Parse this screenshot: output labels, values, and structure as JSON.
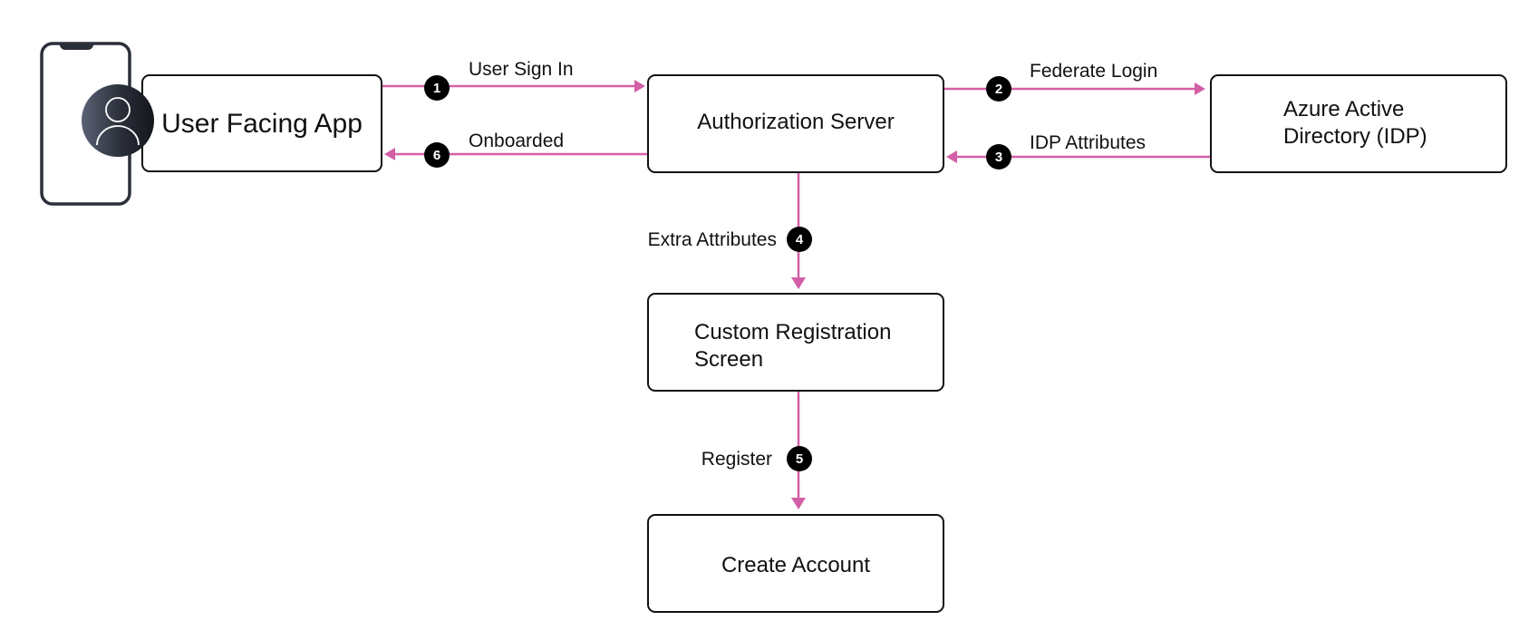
{
  "diagram": {
    "colors": {
      "edge": "#D35FA6",
      "node_border": "#111111",
      "badge_fill": "#000000",
      "badge_text": "#ffffff",
      "phone_frame": "#2b2f3a",
      "avatar_dark": "#1c1f27",
      "avatar_light": "#5a6275"
    },
    "nodes": {
      "user_app": {
        "label": "User Facing App",
        "icon": "user-avatar-icon",
        "device_icon": "smartphone-icon"
      },
      "auth_server": {
        "label": "Authorization Server"
      },
      "azure_ad": {
        "line1": "Azure Active",
        "line2": "Directory (IDP)"
      },
      "custom_reg": {
        "line1": "Custom Registration",
        "line2": "Screen"
      },
      "create_account": {
        "label": "Create Account"
      }
    },
    "edges": [
      {
        "step": "1",
        "label": "User Sign In",
        "from": "User Facing App",
        "to": "Authorization Server"
      },
      {
        "step": "2",
        "label": "Federate Login",
        "from": "Authorization Server",
        "to": "Azure Active Directory (IDP)"
      },
      {
        "step": "3",
        "label": "IDP Attributes",
        "from": "Azure Active Directory (IDP)",
        "to": "Authorization Server"
      },
      {
        "step": "4",
        "label": "Extra Attributes",
        "from": "Authorization Server",
        "to": "Custom Registration Screen"
      },
      {
        "step": "5",
        "label": "Register",
        "from": "Custom Registration Screen",
        "to": "Create Account"
      },
      {
        "step": "6",
        "label": "Onboarded",
        "from": "Authorization Server",
        "to": "User Facing App"
      }
    ]
  }
}
